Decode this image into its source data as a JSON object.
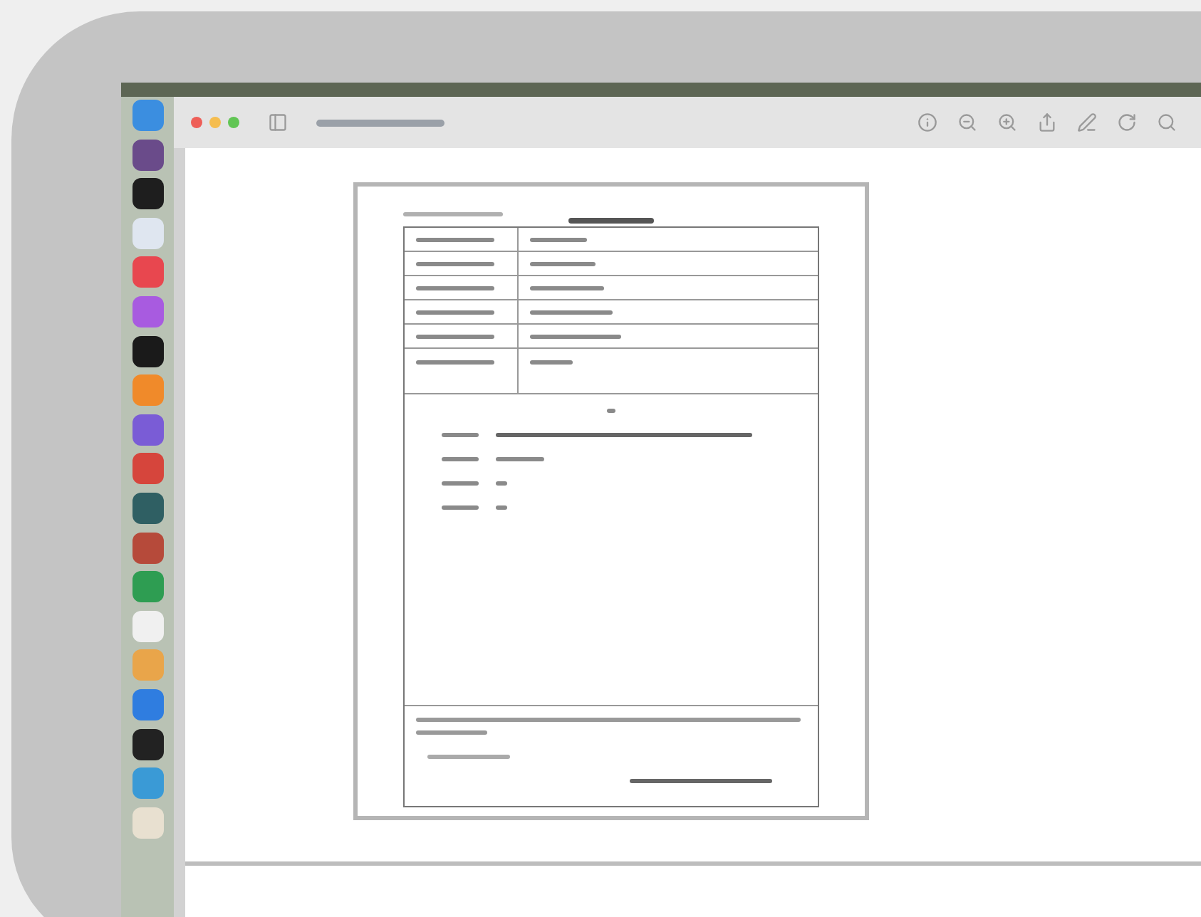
{
  "window": {
    "traffic_lights": [
      {
        "color": "#ee5e57"
      },
      {
        "color": "#f5bd4f"
      },
      {
        "color": "#61c554"
      }
    ]
  },
  "dock": {
    "apps": [
      {
        "color": "#3b8ee0"
      },
      {
        "color": "#6a4b8a"
      },
      {
        "color": "#1e1e1e"
      },
      {
        "color": "#dfe6f0"
      },
      {
        "color": "#e8474f"
      },
      {
        "color": "#a85be0"
      },
      {
        "color": "#1a1a1a"
      },
      {
        "color": "#f08a2a"
      },
      {
        "color": "#7a5cd6"
      },
      {
        "color": "#d6453c"
      },
      {
        "color": "#2f5f63"
      },
      {
        "color": "#b64a3a"
      },
      {
        "color": "#2e9d52"
      },
      {
        "color": "#f0f0f0"
      },
      {
        "color": "#e9a54a"
      },
      {
        "color": "#2f7de0"
      },
      {
        "color": "#222222"
      },
      {
        "color": "#3a9ad6"
      },
      {
        "color": "#e8e0d0"
      }
    ]
  }
}
